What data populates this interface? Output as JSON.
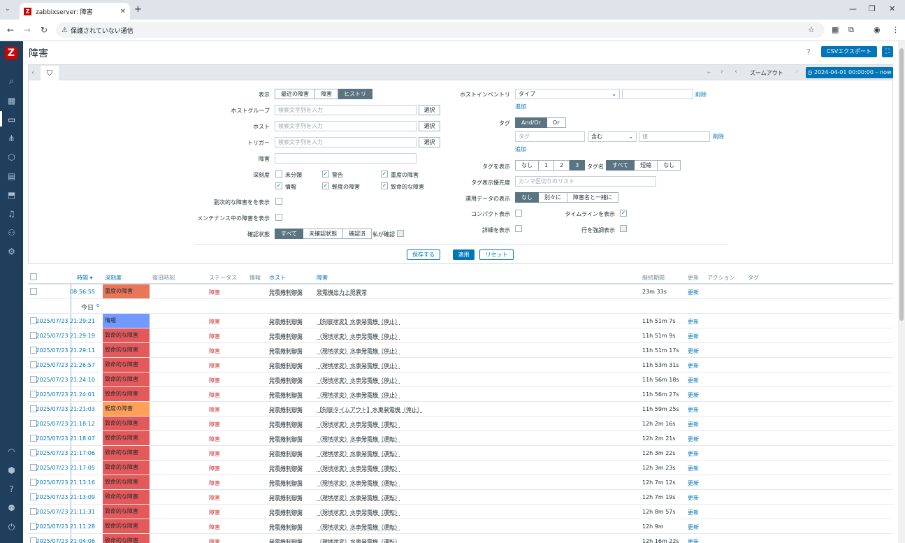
{
  "browser": {
    "tab_title": "zabbixserver: 障害",
    "favicon_letter": "Z",
    "security_label": "保護されていない通信"
  },
  "app": {
    "logo": "Z",
    "page_title": "障害",
    "help": "?",
    "csv_button": "CSVエクスポート"
  },
  "filterbar": {
    "zoom_out": "ズームアウト",
    "time_range": "2024-04-01 00:00:00 – now"
  },
  "filter": {
    "show_label": "表示",
    "show_options": [
      "最近の障害",
      "障害",
      "ヒストリ"
    ],
    "show_selected": 2,
    "hostgroup_label": "ホストグループ",
    "host_label": "ホスト",
    "trigger_label": "トリガー",
    "problem_label": "障害",
    "search_placeholder": "検索文字列を入力",
    "select_button": "選択",
    "severity_label": "深刻度",
    "severities": [
      {
        "label": "未分類",
        "checked": false
      },
      {
        "label": "警告",
        "checked": true
      },
      {
        "label": "重度の障害",
        "checked": true
      },
      {
        "label": "情報",
        "checked": true
      },
      {
        "label": "軽度の障害",
        "checked": true
      },
      {
        "label": "致命的な障害",
        "checked": true
      }
    ],
    "symptom_label": "副次的な障害をを表示",
    "maintenance_label": "メンテナンス中の障害を表示",
    "ack_label": "確認状態",
    "ack_options": [
      "すべて",
      "未確認状態",
      "確認済"
    ],
    "ack_selected": 0,
    "ack_by_me": "私が確認",
    "inventory_label": "ホストインベントリ",
    "inventory_select": "タイプ",
    "remove": "削除",
    "add": "追加",
    "tags_label": "タグ",
    "tags_andor": [
      "And/Or",
      "Or"
    ],
    "tag_placeholder": "タグ",
    "tag_op": "含む",
    "value_placeholder": "値",
    "show_tags_label": "タグを表示",
    "show_tags_options": [
      "なし",
      "1",
      "2",
      "3"
    ],
    "tag_name_label": "タグ名",
    "tag_name_options": [
      "すべて",
      "短縮",
      "なし"
    ],
    "tag_priority_label": "タグ表示優先度",
    "tag_priority_placeholder": "カンマ区切りのリスト",
    "opdata_label": "運用データの表示",
    "opdata_options": [
      "なし",
      "別々に",
      "障害名と一緒に"
    ],
    "compact_label": "コンパクト表示",
    "timeline_label": "タイムラインを表示",
    "details_label": "詳細を表示",
    "highlight_label": "行を強調表示",
    "save_button": "保存する",
    "apply_button": "適用",
    "reset_button": "リセット"
  },
  "table": {
    "headers": {
      "time": "時間 ▾",
      "severity": "深刻度",
      "recovery": "復旧時刻",
      "status": "ステータス",
      "info": "情報",
      "host": "ホスト",
      "problem": "障害",
      "duration": "継続期間",
      "update": "更新",
      "actions": "アクション",
      "tags": "タグ"
    },
    "today_label": "今日",
    "first_row": {
      "time": "08:56:55",
      "severity": "重度の障害",
      "sev_color": "#e97659",
      "status": "障害",
      "host": "発電機制御盤",
      "problem": "発電機出力上限異常",
      "duration": "23m 33s",
      "update": "更新"
    },
    "rows": [
      {
        "time": "2025/07/23 21:29:21",
        "severity": "情報",
        "sev_color": "#7499ff",
        "status": "障害",
        "host": "発電機制御盤",
        "problem": "【制御状変】水車発電機（停止）",
        "duration": "11h 51m 7s",
        "update": "更新"
      },
      {
        "time": "2025/07/23 21:29:19",
        "severity": "致命的な障害",
        "sev_color": "#e45959",
        "status": "障害",
        "host": "発電機制御盤",
        "problem": "（現地状変）水車発電機（停止）",
        "duration": "11h 51m 9s",
        "update": "更新"
      },
      {
        "time": "2025/07/23 21:29:11",
        "severity": "致命的な障害",
        "sev_color": "#e45959",
        "status": "障害",
        "host": "発電機制御盤",
        "problem": "（現地状変）水車発電機（停止）",
        "duration": "11h 51m 17s",
        "update": "更新"
      },
      {
        "time": "2025/07/23 21:26:57",
        "severity": "致命的な障害",
        "sev_color": "#e45959",
        "status": "障害",
        "host": "発電機制御盤",
        "problem": "（現地状変）水車発電機（停止）",
        "duration": "11h 53m 31s",
        "update": "更新"
      },
      {
        "time": "2025/07/23 21:24:10",
        "severity": "致命的な障害",
        "sev_color": "#e45959",
        "status": "障害",
        "host": "発電機制御盤",
        "problem": "（現地状変）水車発電機（停止）",
        "duration": "11h 56m 18s",
        "update": "更新"
      },
      {
        "time": "2025/07/23 21:24:01",
        "severity": "致命的な障害",
        "sev_color": "#e45959",
        "status": "障害",
        "host": "発電機制御盤",
        "problem": "（現地状変）水車発電機（停止）",
        "duration": "11h 56m 27s",
        "update": "更新"
      },
      {
        "time": "2025/07/23 21:21:03",
        "severity": "軽度の障害",
        "sev_color": "#ffa059",
        "status": "障害",
        "host": "発電機制御盤",
        "problem": "【制御タイムアウト】水車発電機（停止）",
        "duration": "11h 59m 25s",
        "update": "更新"
      },
      {
        "time": "2025/07/23 21:18:12",
        "severity": "致命的な障害",
        "sev_color": "#e45959",
        "status": "障害",
        "host": "発電機制御盤",
        "problem": "（現地状変）水車発電機（運転）",
        "duration": "12h 2m 16s",
        "update": "更新"
      },
      {
        "time": "2025/07/23 21:18:07",
        "severity": "致命的な障害",
        "sev_color": "#e45959",
        "status": "障害",
        "host": "発電機制御盤",
        "problem": "（現地状変）水車発電機（運転）",
        "duration": "12h 2m 21s",
        "update": "更新"
      },
      {
        "time": "2025/07/23 21:17:06",
        "severity": "致命的な障害",
        "sev_color": "#e45959",
        "status": "障害",
        "host": "発電機制御盤",
        "problem": "（現地状変）水車発電機（運転）",
        "duration": "12h 3m 22s",
        "update": "更新"
      },
      {
        "time": "2025/07/23 21:17:05",
        "severity": "致命的な障害",
        "sev_color": "#e45959",
        "status": "障害",
        "host": "発電機制御盤",
        "problem": "（現地状変）水車発電機（運転）",
        "duration": "12h 3m 23s",
        "update": "更新"
      },
      {
        "time": "2025/07/23 21:13:16",
        "severity": "致命的な障害",
        "sev_color": "#e45959",
        "status": "障害",
        "host": "発電機制御盤",
        "problem": "（現地状変）水車発電機（運転）",
        "duration": "12h 7m 12s",
        "update": "更新"
      },
      {
        "time": "2025/07/23 21:13:09",
        "severity": "致命的な障害",
        "sev_color": "#e45959",
        "status": "障害",
        "host": "発電機制御盤",
        "problem": "（現地状変）水車発電機（運転）",
        "duration": "12h 7m 19s",
        "update": "更新"
      },
      {
        "time": "2025/07/23 21:11:31",
        "severity": "致命的な障害",
        "sev_color": "#e45959",
        "status": "障害",
        "host": "発電機制御盤",
        "problem": "（現地状変）水車発電機（運転）",
        "duration": "12h 8m 57s",
        "update": "更新"
      },
      {
        "time": "2025/07/23 21:11:28",
        "severity": "致命的な障害",
        "sev_color": "#e45959",
        "status": "障害",
        "host": "発電機制御盤",
        "problem": "（現地状変）水車発電機（運転）",
        "duration": "12h 9m",
        "update": "更新"
      },
      {
        "time": "2025/07/23 21:04:06",
        "severity": "致命的な障害",
        "sev_color": "#e45959",
        "status": "障害",
        "host": "発電機制御盤",
        "problem": "（現地状変）水車発電機（運転）",
        "duration": "12h 16m 22s",
        "update": "更新"
      }
    ]
  }
}
